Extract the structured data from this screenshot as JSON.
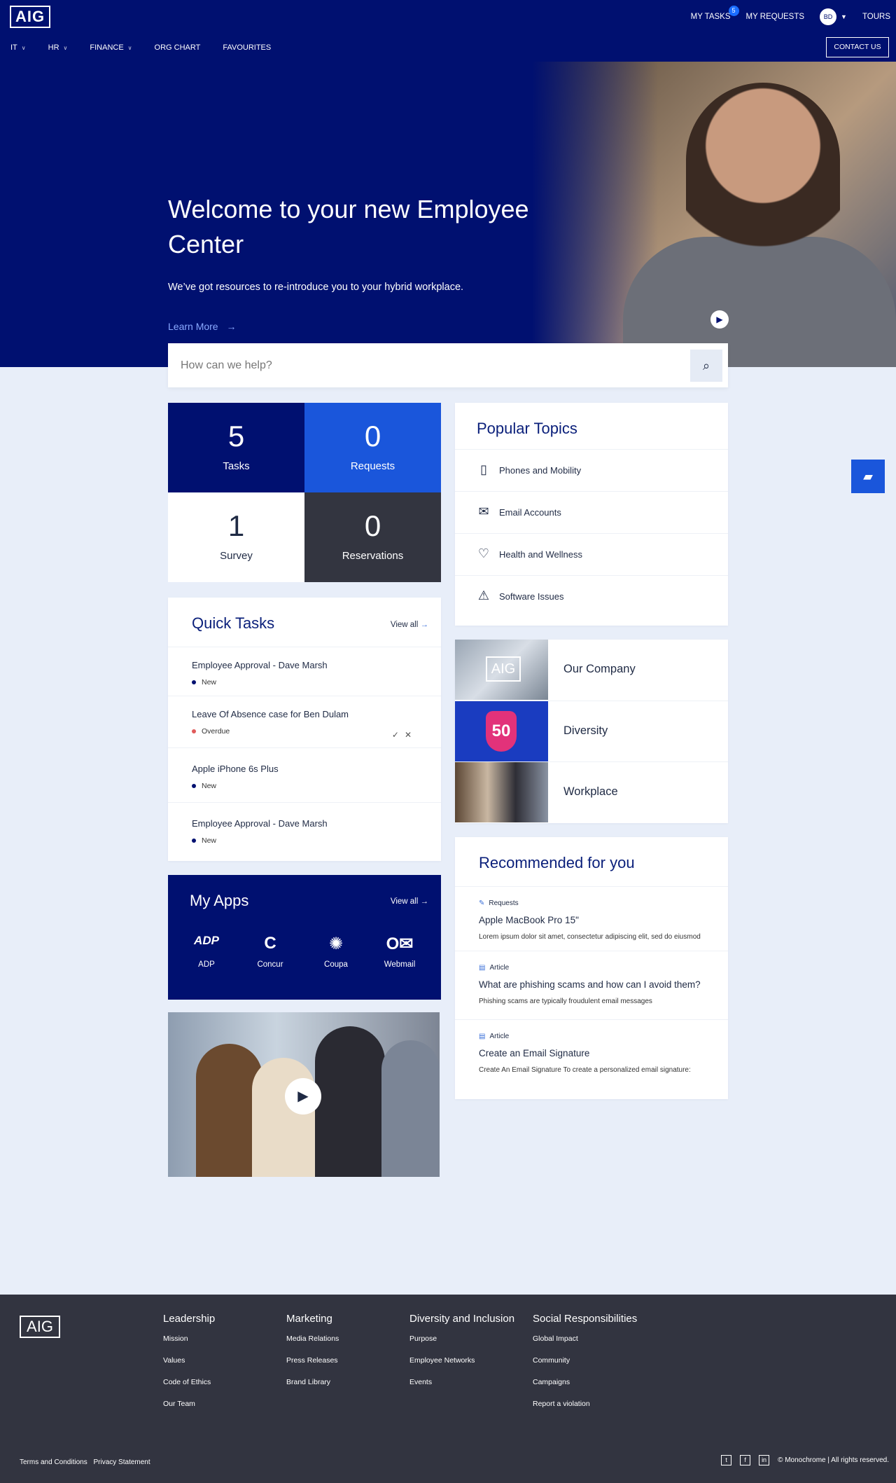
{
  "brand": {
    "logo_text": "AIG",
    "primary_color": "#001070",
    "accent_color": "#1a56db",
    "footer_color": "#323440"
  },
  "header": {
    "my_tasks": "MY TASKS",
    "tasks_badge": "5",
    "my_requests": "MY REQUESTS",
    "avatar_initials": "BD",
    "tours": "TOURS",
    "contact": "CONTACT US",
    "nav": [
      "IT",
      "HR",
      "FINANCE",
      "ORG CHART",
      "FAVOURITES"
    ]
  },
  "hero": {
    "title": "Welcome to your new Employee Center",
    "subtitle": "We’ve got resources to re-introduce you to your hybrid workplace.",
    "link": "Learn More"
  },
  "search": {
    "placeholder": "How can we help?"
  },
  "stats": [
    {
      "value": "5",
      "label": "Tasks"
    },
    {
      "value": "0",
      "label": "Requests"
    },
    {
      "value": "1",
      "label": "Survey"
    },
    {
      "value": "0",
      "label": "Reservations"
    }
  ],
  "quick_tasks": {
    "title": "Quick Tasks",
    "view_all": "View all",
    "items": [
      {
        "title": "Employee Approval - Dave Marsh",
        "status": "New"
      },
      {
        "title": "Leave Of Absence case for Ben Dulam",
        "status": "Overdue"
      },
      {
        "title": "Apple iPhone 6s Plus",
        "status": "New"
      },
      {
        "title": "Employee Approval - Dave Marsh",
        "status": "New"
      }
    ]
  },
  "my_apps": {
    "title": "My Apps",
    "view_all": "View all",
    "apps": [
      {
        "label": "ADP",
        "icon": "adp-icon"
      },
      {
        "label": "Concur",
        "icon": "concur-icon"
      },
      {
        "label": "Coupa",
        "icon": "coupa-icon"
      },
      {
        "label": "Webmail",
        "icon": "outlook-icon"
      }
    ]
  },
  "popular_topics": {
    "title": "Popular Topics",
    "items": [
      {
        "label": "Phones and Mobility",
        "icon": "phone-icon"
      },
      {
        "label": "Email Accounts",
        "icon": "envelope-icon"
      },
      {
        "label": "Health and Wellness",
        "icon": "heart-icon"
      },
      {
        "label": "Software Issues",
        "icon": "warning-icon"
      }
    ]
  },
  "features": [
    {
      "label": "Our Company",
      "image_text": "AIG"
    },
    {
      "label": "Diversity",
      "image_text": "50"
    },
    {
      "label": "Workplace",
      "image_text": ""
    }
  ],
  "recommended": {
    "title": "Recommended for you",
    "items": [
      {
        "kind": "Requests",
        "title": "Apple MacBook Pro 15\"",
        "summary": "Lorem ipsum dolor sit amet, consectetur adipiscing elit, sed do eiusmod"
      },
      {
        "kind": "Article",
        "title": "What are phishing scams and how can I avoid them?",
        "summary": "Phishing scams are typically froudulent email messages"
      },
      {
        "kind": "Article",
        "title": "Create an Email Signature",
        "summary": "Create An Email Signature To create a personalized email signature:"
      }
    ]
  },
  "footer": {
    "columns": [
      {
        "title": "Leadership",
        "links": [
          "Mission",
          "Values",
          "Code of Ethics",
          "Our Team"
        ]
      },
      {
        "title": "Marketing",
        "links": [
          "Media Relations",
          "Press Releases",
          "Brand Library"
        ]
      },
      {
        "title": "Diversity and Inclusion",
        "links": [
          "Purpose",
          "Employee Networks",
          "Events"
        ]
      },
      {
        "title": "Social Responsibilities",
        "links": [
          "Global Impact",
          "Community",
          "Campaigns",
          "Report a violation"
        ]
      }
    ],
    "terms": "Terms and Conditions",
    "privacy": "Privacy Statement",
    "copyright": "© Monochrome |  All rights reserved."
  }
}
